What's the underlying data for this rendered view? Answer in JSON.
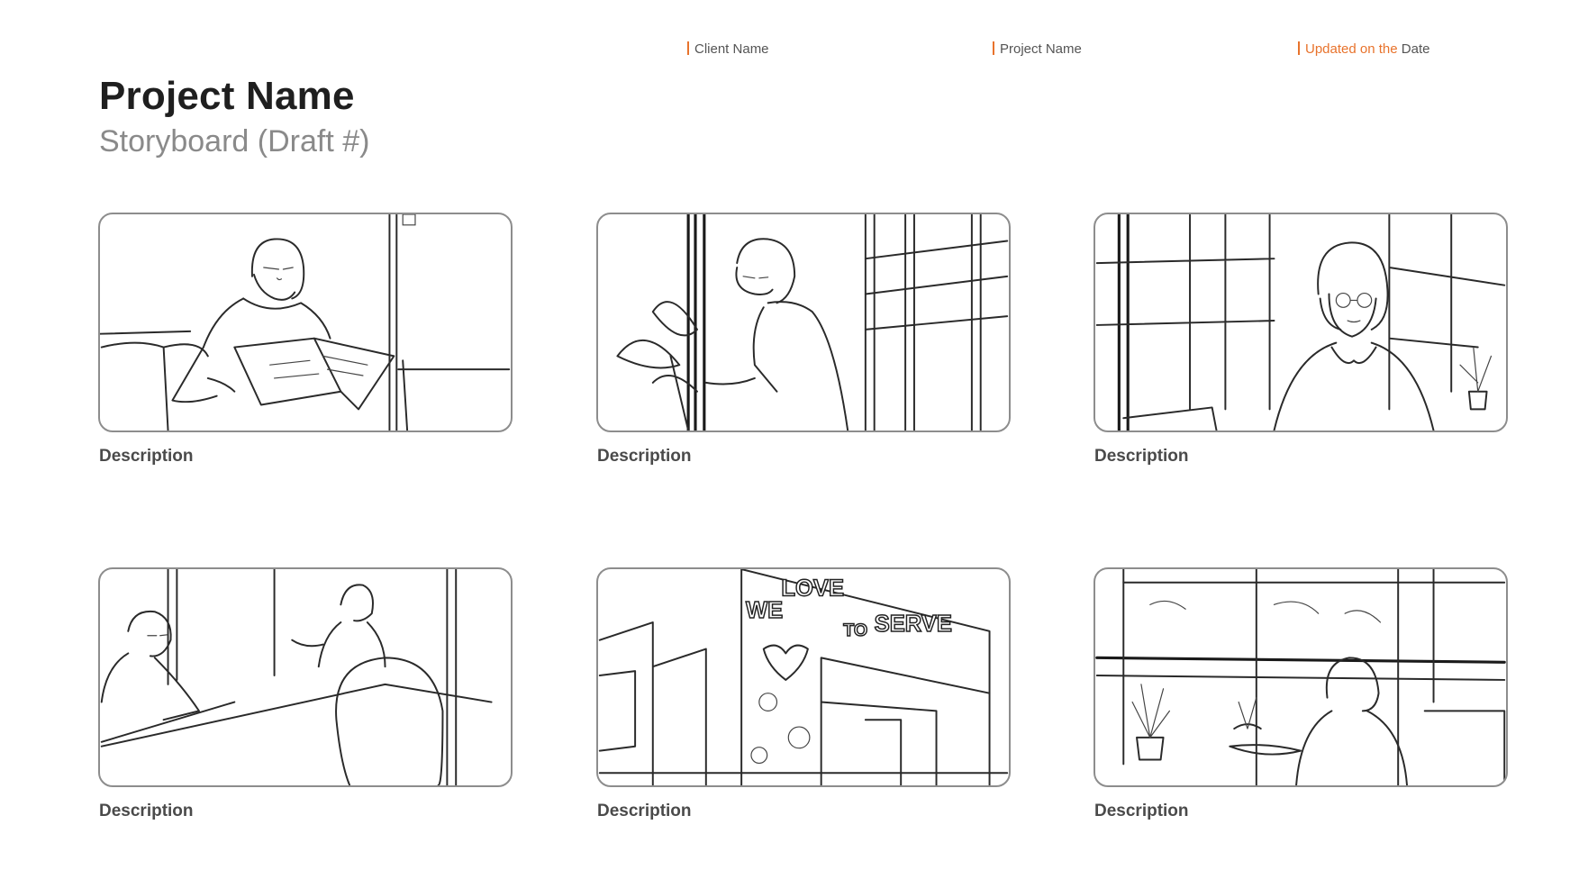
{
  "header": {
    "client_label": "Client Name",
    "project_label": "Project Name",
    "updated_prefix": "Updated on the",
    "updated_date": "Date",
    "accent_color": "#e8732c"
  },
  "title": "Project Name",
  "subtitle": "Storyboard (Draft #)",
  "panels": [
    {
      "description": "Description",
      "sketch": "woman-reading-book-on-couch"
    },
    {
      "description": "Description",
      "sketch": "woman-tending-plant-by-windows"
    },
    {
      "description": "Description",
      "sketch": "woman-portrait-by-windows"
    },
    {
      "description": "Description",
      "sketch": "meeting-around-table"
    },
    {
      "description": "Description",
      "sketch": "mural-wall-we-love-to-serve"
    },
    {
      "description": "Description",
      "sketch": "person-at-window-with-plants"
    }
  ],
  "mural_text": [
    "WE",
    "LOVE",
    "TO",
    "SERVE"
  ]
}
